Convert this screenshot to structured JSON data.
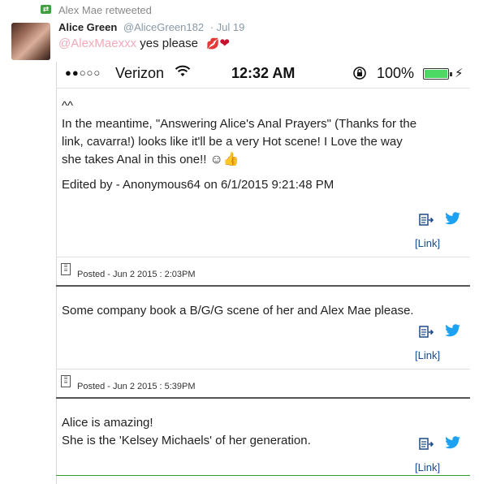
{
  "retweet": {
    "icon": "retweet-icon",
    "label": "Alex Mae retweeted"
  },
  "tweet": {
    "author_name": "Alice Green",
    "author_handle": "@AliceGreen182",
    "date": "· Jul 19",
    "mention": "@AlexMaexxx",
    "text": "yes please",
    "emoji_lips": "💋",
    "emoji_heart": "❤"
  },
  "status_bar": {
    "signal": "●●○○○",
    "carrier": "Verizon",
    "wifi": "wifi-icon",
    "time": "12:32 AM",
    "lock": "rotation-lock-icon",
    "battery_percent": "100%",
    "battery_level": 1.0,
    "charging": "bolt-icon"
  },
  "comments": [
    {
      "lines": [
        "^^",
        "In the meantime, \"Answering Alice's Anal Prayers\" (Thanks for the",
        "link, cavarra!) looks like it'll be a very Hot scene! I Love the way",
        "she takes Anal in this one!!"
      ],
      "smiley": "☺👍",
      "edited": "Edited by - Anonymous64 on 6/1/2015 9:21:48 PM",
      "link_label": "[Link]"
    },
    {
      "posted": "Posted - Jun 2 2015 : 2:03PM",
      "lines": [
        "Some company book a B/G/G scene of her and Alex Mae please."
      ],
      "link_label": "[Link]"
    },
    {
      "posted": "Posted - Jun 2 2015 : 5:39PM",
      "lines": [
        "Alice is amazing!",
        "She is the 'Kelsey Michaels' of her generation."
      ],
      "link_label": "[Link]"
    }
  ],
  "colors": {
    "mention": "#f4a9b8",
    "link": "#1a4b8c",
    "twitter_blue": "#1da1f2",
    "battery_green": "#4cd964",
    "retweet_green": "#3fa03f"
  }
}
